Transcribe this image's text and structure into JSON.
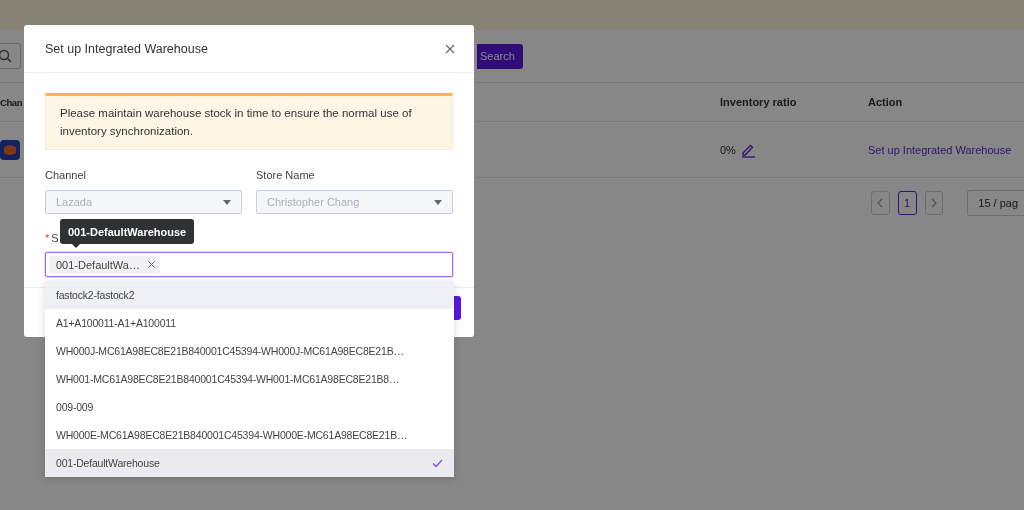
{
  "page": {
    "search_button": "Search",
    "table": {
      "columns": [
        "Chan",
        "Inventory ratio",
        "Action"
      ],
      "rows": [
        {
          "ratio": "0%",
          "action": "Set up Integrated Warehouse"
        }
      ]
    },
    "pagination": {
      "pages": [
        {
          "label": "1",
          "selected": true
        }
      ],
      "page_size": "15 / pag"
    }
  },
  "modal": {
    "title": "Set up Integrated Warehouse",
    "alert": "Please maintain warehouse stock in time to ensure the normal use of inventory synchronization.",
    "fields": [
      {
        "label": "Channel",
        "value": "Lazada",
        "disabled": true
      },
      {
        "label": "Store Name",
        "value": "Christopher Chang",
        "disabled": true
      }
    ],
    "warehouse": {
      "mark": "*",
      "label": "S",
      "tags": [
        "001-DefaultWa…"
      ]
    }
  },
  "tooltip": "001-DefaultWarehouse",
  "dropdown": {
    "options": [
      {
        "label": "fastock2-fastock2",
        "selected": false,
        "hovered": true
      },
      {
        "label": "A1+A100011-A1+A100011",
        "selected": false,
        "hovered": false
      },
      {
        "label": "WH000J-MC61A98EC8E21B840001C45394-WH000J-MC61A98EC8E21B…",
        "selected": false,
        "hovered": false
      },
      {
        "label": "WH001-MC61A98EC8E21B840001C45394-WH001-MC61A98EC8E21B8…",
        "selected": false,
        "hovered": false
      },
      {
        "label": "009-009",
        "selected": false,
        "hovered": false
      },
      {
        "label": "WH000E-MC61A98EC8E21B840001C45394-WH000E-MC61A98EC8E21B…",
        "selected": false,
        "hovered": false
      },
      {
        "label": "001-DefaultWarehouse",
        "selected": true,
        "hovered": false
      }
    ]
  }
}
